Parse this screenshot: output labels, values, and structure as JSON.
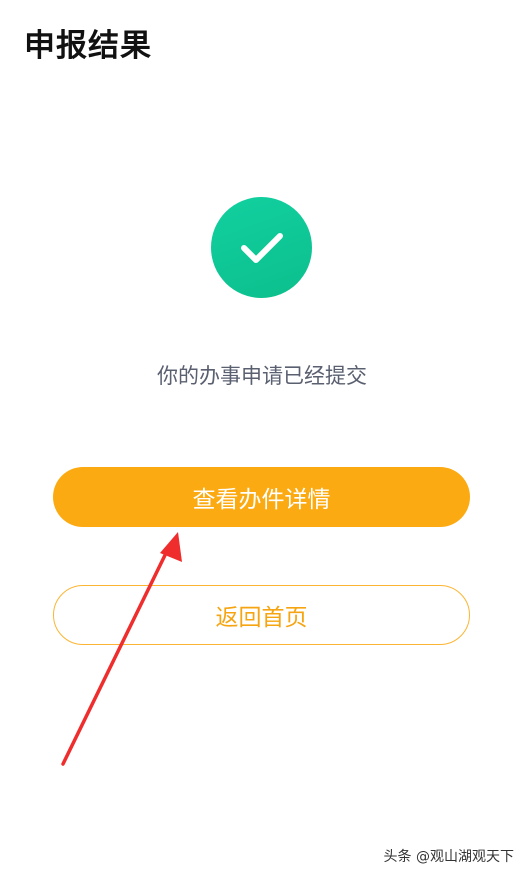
{
  "header": {
    "title": "申报结果"
  },
  "status": {
    "icon": "check-circle-icon",
    "icon_color": "#10c896",
    "message": "你的办事申请已经提交"
  },
  "actions": {
    "primary_label": "查看办件详情",
    "primary_color": "#fcaa12",
    "secondary_label": "返回首页",
    "secondary_color": "#f6a512"
  },
  "watermark": {
    "text": "头条 @观山湖观天下"
  }
}
